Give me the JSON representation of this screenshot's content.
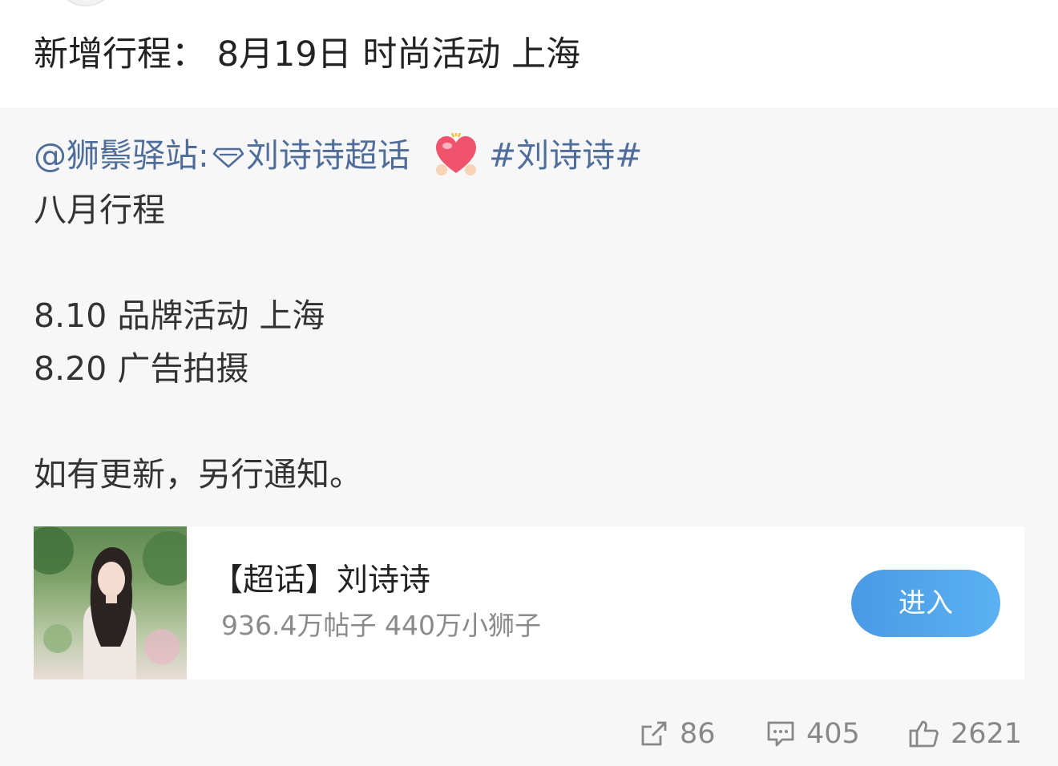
{
  "post": {
    "title": "新增行程： 8月19日 时尚活动 上海"
  },
  "repost": {
    "mention": "@狮鬃驿站:",
    "supertopic_link": "刘诗诗超话",
    "hashtag": "#刘诗诗#",
    "lines": [
      "八月行程",
      "8.10 品牌活动 上海",
      "8.20 广告拍摄",
      "如有更新，另行通知。"
    ]
  },
  "card": {
    "title": "【超话】刘诗诗",
    "stats": "936.4万帖子 440万小狮子",
    "enter_label": "进入"
  },
  "actions": {
    "repost_count": "86",
    "comment_count": "405",
    "like_count": "2621"
  },
  "colors": {
    "link": "#4f6d9b",
    "button": "#4a9ae4",
    "muted": "#888888"
  },
  "icons": [
    "diamond-icon",
    "heart-emoji-icon",
    "repost-icon",
    "comment-icon",
    "like-icon"
  ]
}
